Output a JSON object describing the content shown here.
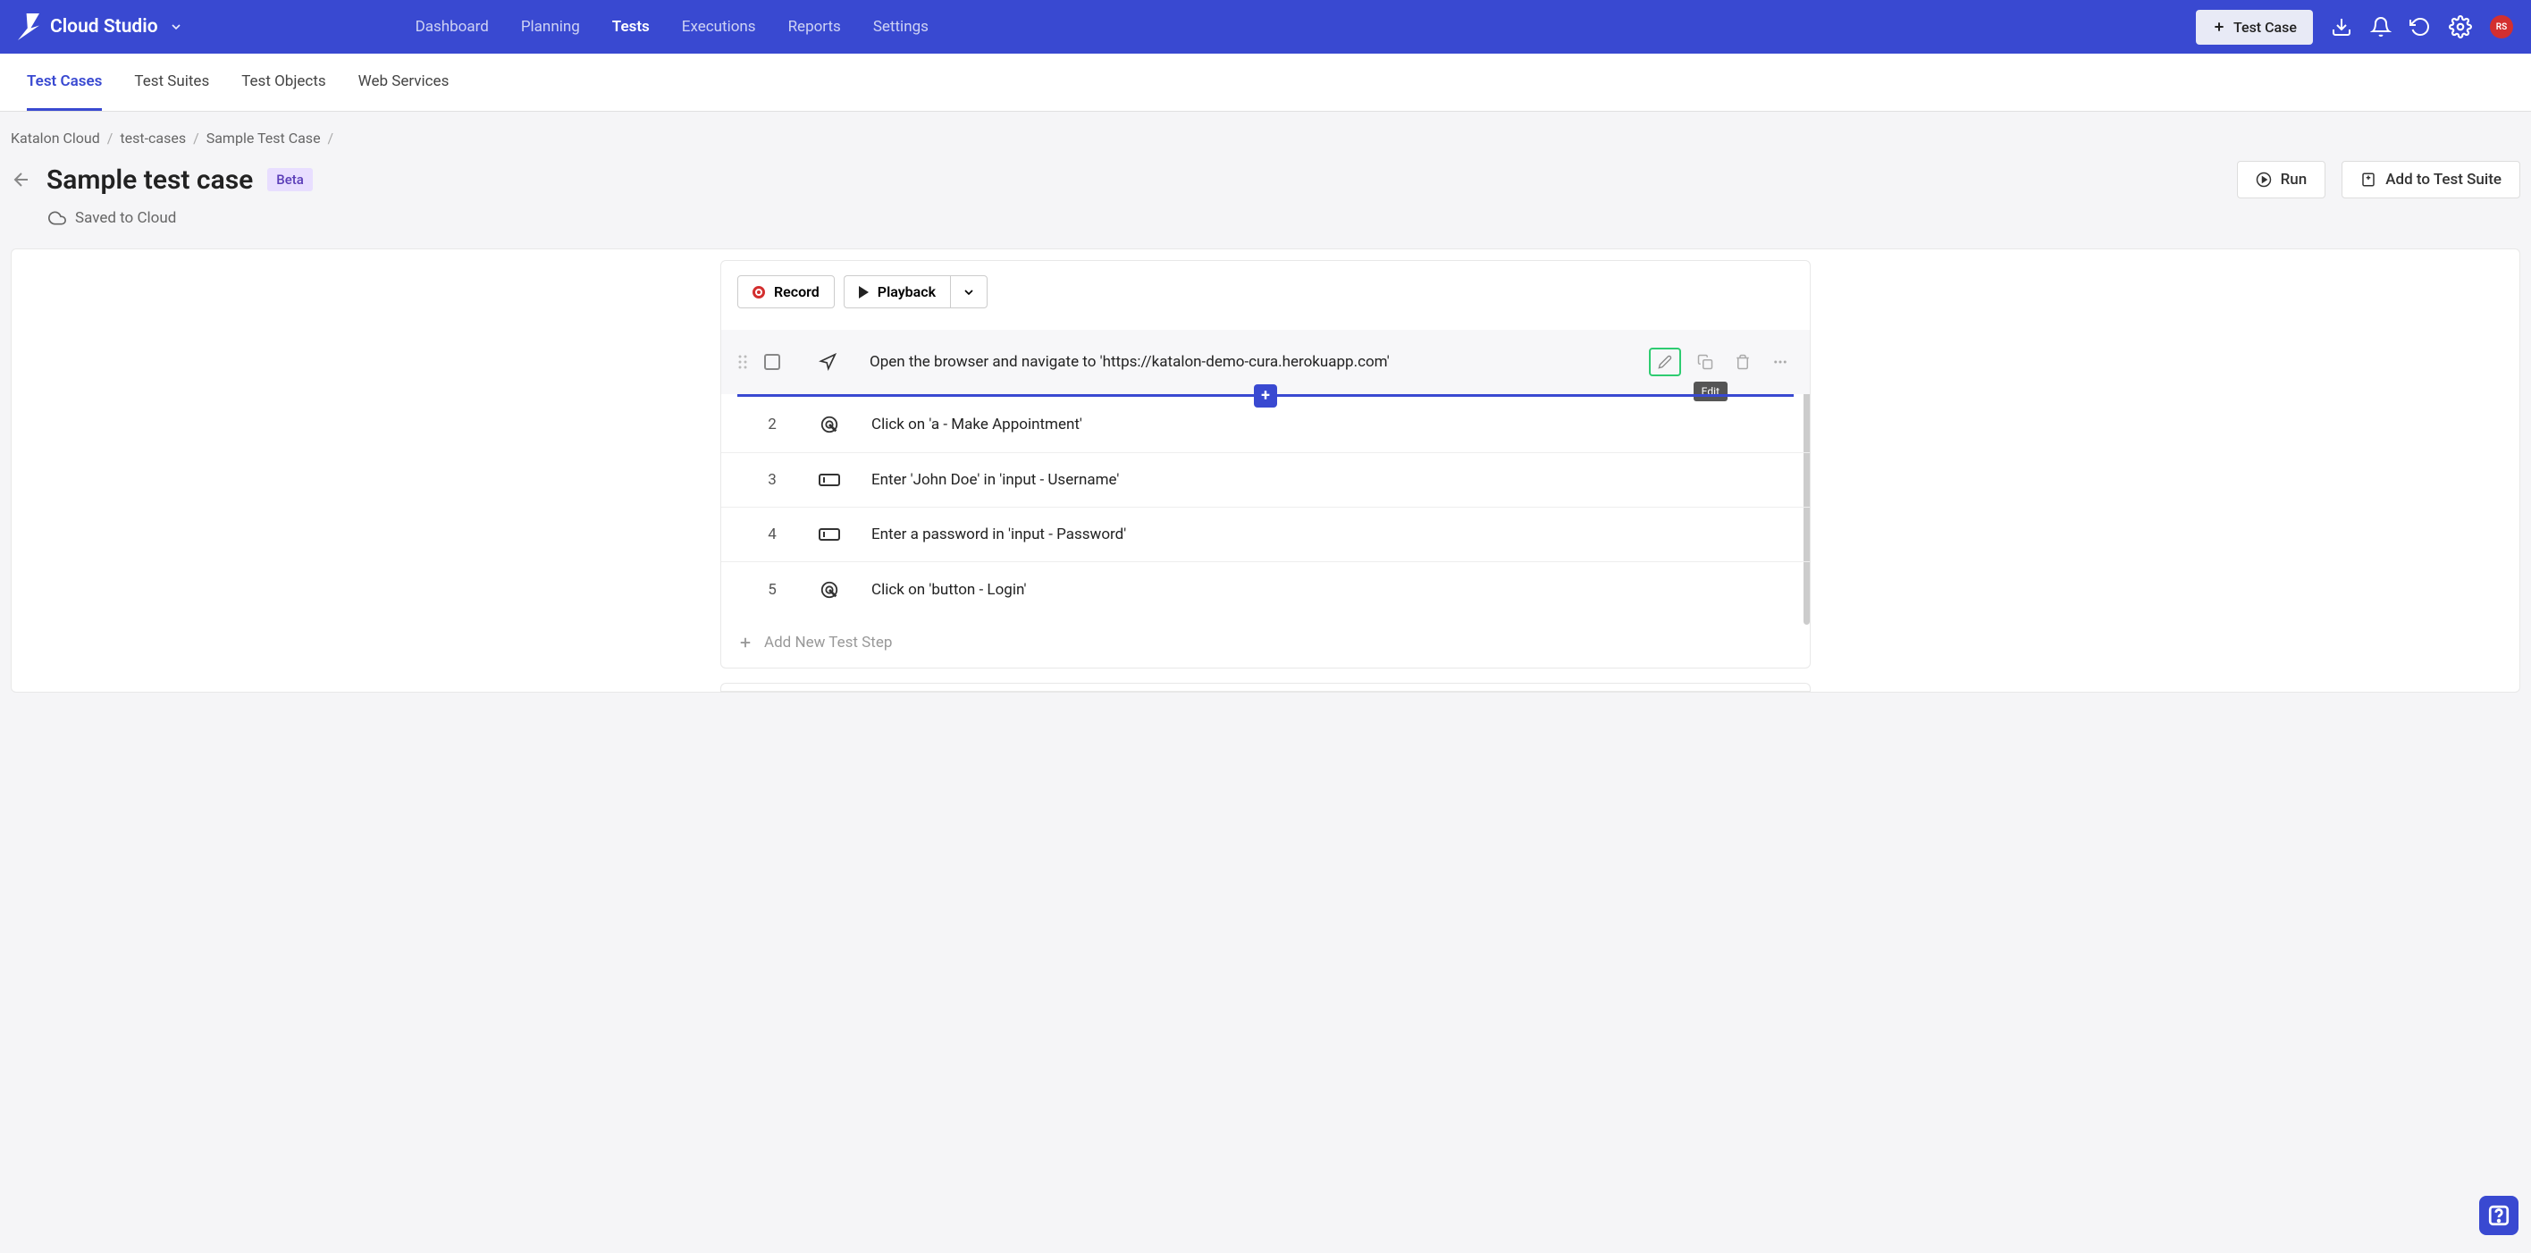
{
  "brand": {
    "name": "Cloud Studio"
  },
  "nav": {
    "dashboard": "Dashboard",
    "planning": "Planning",
    "tests": "Tests",
    "executions": "Executions",
    "reports": "Reports",
    "settings": "Settings"
  },
  "topbar": {
    "new_testcase": "Test Case",
    "avatar_initials": "RS"
  },
  "subtabs": {
    "test_cases": "Test Cases",
    "test_suites": "Test Suites",
    "test_objects": "Test Objects",
    "web_services": "Web Services"
  },
  "breadcrumb": {
    "root": "Katalon Cloud",
    "folder": "test-cases",
    "item": "Sample Test Case"
  },
  "page": {
    "title": "Sample test case",
    "beta": "Beta",
    "saved": "Saved to Cloud",
    "run": "Run",
    "add_to_suite": "Add to Test Suite"
  },
  "toolbar": {
    "record": "Record",
    "playback": "Playback"
  },
  "steps": [
    {
      "num": "",
      "text": "Open the browser and navigate to 'https://katalon-demo-cura.herokuapp.com'",
      "icon": "navigate"
    },
    {
      "num": "2",
      "text": "Click on 'a - Make Appointment'",
      "icon": "click"
    },
    {
      "num": "3",
      "text": "Enter 'John Doe' in 'input - Username'",
      "icon": "input"
    },
    {
      "num": "4",
      "text": "Enter a password in 'input - Password'",
      "icon": "input"
    },
    {
      "num": "5",
      "text": "Click on 'button - Login'",
      "icon": "click"
    }
  ],
  "tooltip": {
    "edit": "Edit"
  },
  "add_step": "Add New Test Step"
}
